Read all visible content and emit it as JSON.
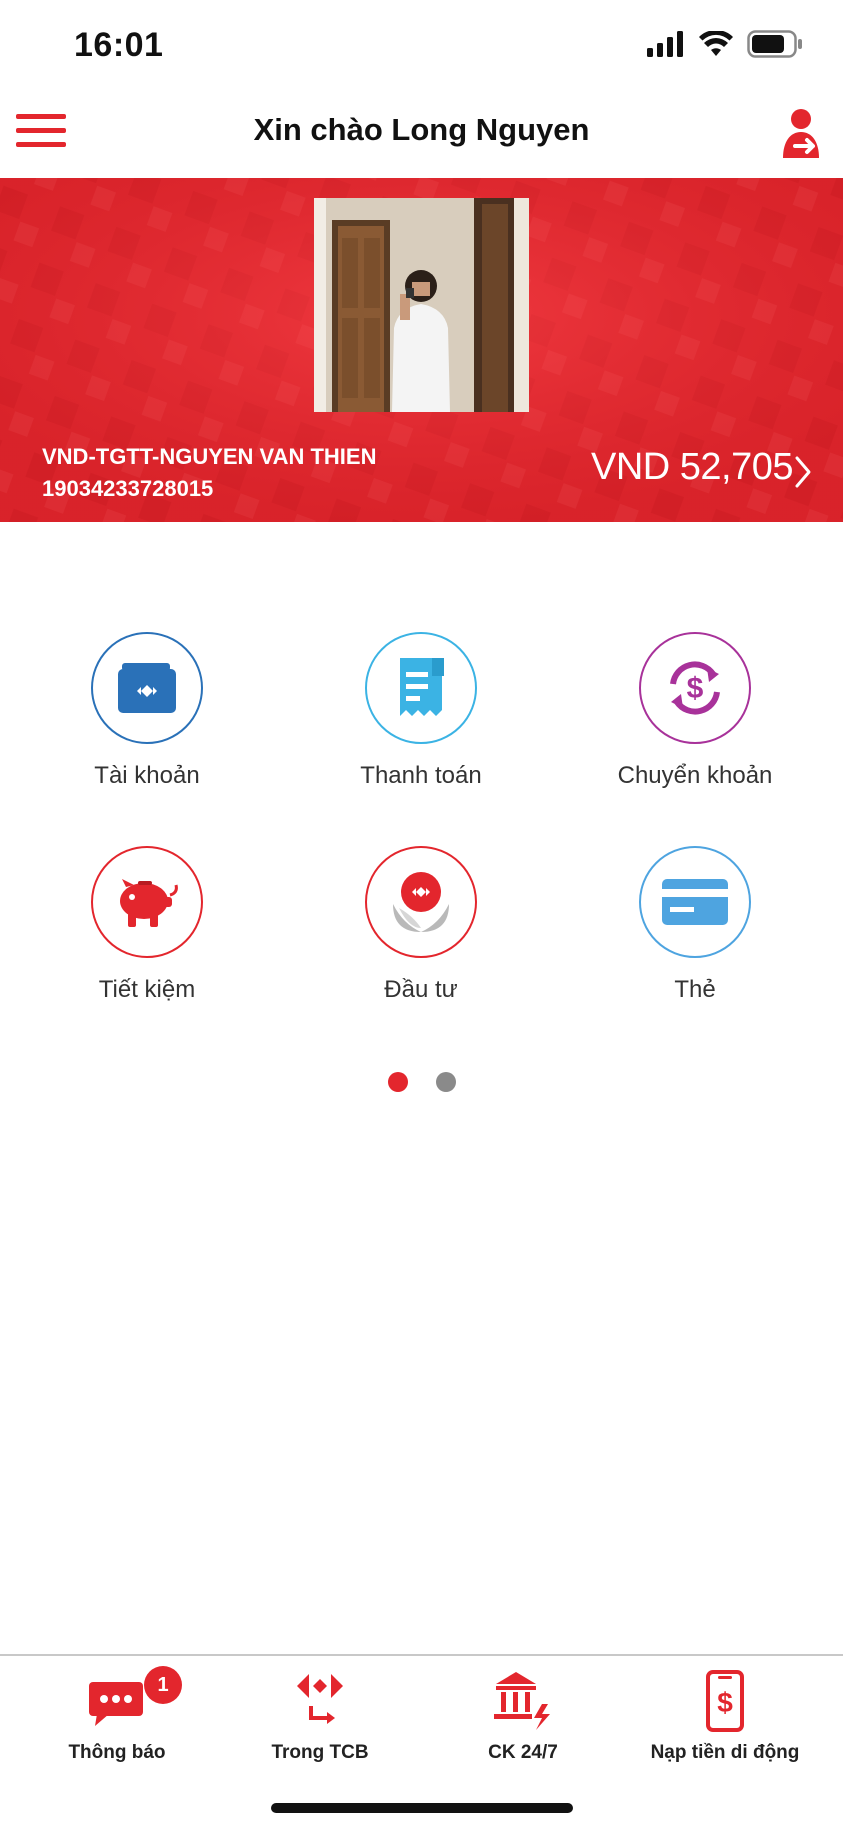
{
  "status_bar": {
    "time": "16:01",
    "icons": [
      "signal-icon",
      "wifi-icon",
      "battery-icon"
    ]
  },
  "header": {
    "title": "Xin chào Long Nguyen",
    "menu_icon": "hamburger-menu-icon",
    "profile_icon": "user-transfer-icon"
  },
  "account": {
    "name": "VND-TGTT-NGUYEN VAN THIEN",
    "number": "19034233728015",
    "balance": "VND 52,705"
  },
  "services": [
    {
      "label": "Tài khoản",
      "icon": "wallet-icon",
      "color": "#2a71b8"
    },
    {
      "label": "Thanh toán",
      "icon": "receipt-icon",
      "color": "#3bb3e4"
    },
    {
      "label": "Chuyển khoản",
      "icon": "dollar-exchange-icon",
      "color": "#a8329a"
    },
    {
      "label": "Tiết kiệm",
      "icon": "piggy-bank-icon",
      "color": "#e3262d"
    },
    {
      "label": "Đầu tư",
      "icon": "investment-plant-icon",
      "color": "#e3262d"
    },
    {
      "label": "Thẻ",
      "icon": "card-icon",
      "color": "#4ea4e0"
    }
  ],
  "pagination": {
    "active_color": "#e3262d",
    "inactive_color": "#8a8a8a"
  },
  "bottom_nav": [
    {
      "label": "Thông báo",
      "icon": "chat-bubble-icon",
      "badge": "1"
    },
    {
      "label": "Trong TCB",
      "icon": "tcb-transfer-icon"
    },
    {
      "label": "CK 24/7",
      "icon": "bank-fast-transfer-icon"
    },
    {
      "label": "Nạp tiền di động",
      "icon": "mobile-topup-icon"
    }
  ],
  "colors": {
    "brand_red": "#e3262d"
  }
}
